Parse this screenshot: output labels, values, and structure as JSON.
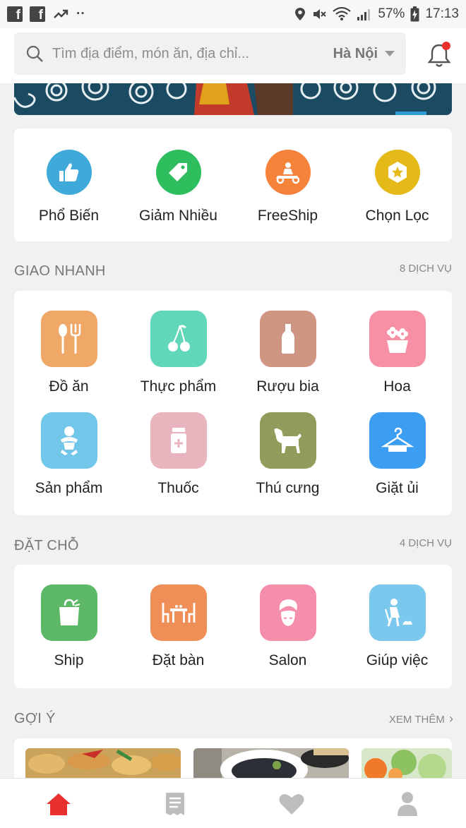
{
  "status_bar": {
    "battery": "57%",
    "time": "17:13",
    "dots": "··"
  },
  "search": {
    "placeholder": "Tìm địa điểm, món ăn, địa chỉ...",
    "city": "Hà Nội"
  },
  "quick_categories": [
    {
      "label": "Phổ Biến",
      "color": "#3fa9d9",
      "icon": "thumbs-up-icon"
    },
    {
      "label": "Giảm Nhiều",
      "color": "#2fbe5e",
      "icon": "tag-icon"
    },
    {
      "label": "FreeShip",
      "color": "#f5833a",
      "icon": "scooter-icon"
    },
    {
      "label": "Chọn Lọc",
      "color": "#e4b918",
      "icon": "star-badge-icon"
    }
  ],
  "giao_nhanh": {
    "title": "GIAO NHANH",
    "count": "8 DỊCH VỤ",
    "items": [
      {
        "label": "Đồ ăn",
        "color": "#f0a868",
        "icon": "spoon-fork-icon"
      },
      {
        "label": "Thực phẩm",
        "color": "#5fd7b8",
        "icon": "cherry-icon"
      },
      {
        "label": "Rượu bia",
        "color": "#cf9583",
        "icon": "bottle-icon"
      },
      {
        "label": "Hoa",
        "color": "#f790a5",
        "icon": "flower-pot-icon"
      },
      {
        "label": "Sản phẩm",
        "color": "#72c6ea",
        "icon": "baby-icon"
      },
      {
        "label": "Thuốc",
        "color": "#e8b4be",
        "icon": "medicine-bottle-icon"
      },
      {
        "label": "Thú cưng",
        "color": "#8f9c5c",
        "icon": "dog-icon"
      },
      {
        "label": "Giặt ủi",
        "color": "#3c9ef1",
        "icon": "hanger-icon"
      }
    ]
  },
  "dat_cho": {
    "title": "ĐẶT CHỖ",
    "count": "4 DỊCH VỤ",
    "items": [
      {
        "label": "Ship",
        "color": "#5cb866",
        "icon": "shopping-bag-icon"
      },
      {
        "label": "Đặt bàn",
        "color": "#ef8f57",
        "icon": "dining-table-icon"
      },
      {
        "label": "Salon",
        "color": "#f48eaa",
        "icon": "salon-icon"
      },
      {
        "label": "Giúp việc",
        "color": "#7ac8ee",
        "icon": "cleaning-icon"
      }
    ]
  },
  "goi_y": {
    "title": "GỢI Ý",
    "more": "XEM THÊM",
    "more_arrow": "›"
  },
  "bottom_nav": [
    "home-icon",
    "orders-icon",
    "favorites-icon",
    "profile-icon"
  ],
  "colors": {
    "accent": "#e8312f",
    "banner": "#1b4b63"
  }
}
